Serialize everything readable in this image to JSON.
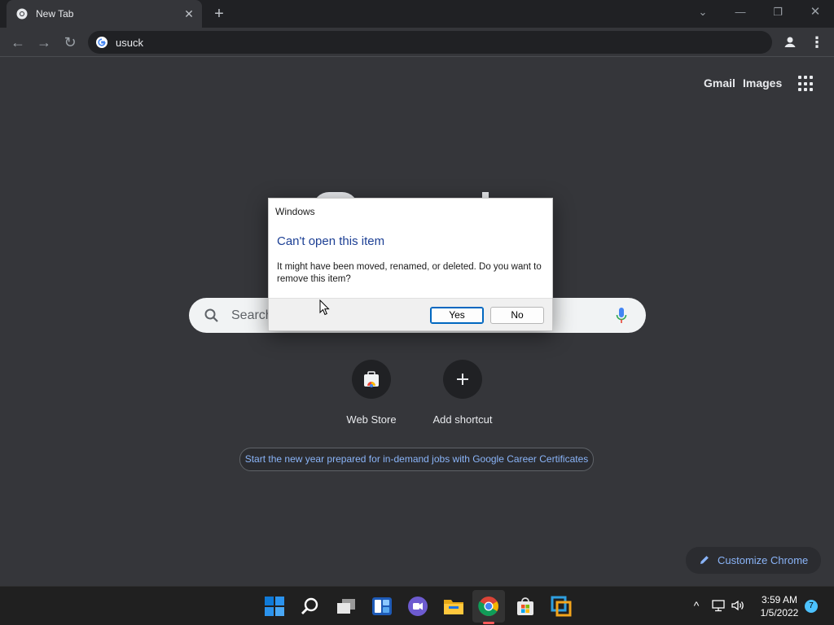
{
  "browser": {
    "tab": {
      "title": "New Tab"
    },
    "omnibox": {
      "value": "usuck"
    }
  },
  "ntp": {
    "top_links": {
      "gmail": "Gmail",
      "images": "Images"
    },
    "search_placeholder": "Search",
    "shortcuts": [
      {
        "label": "Web Store"
      },
      {
        "label": "Add shortcut"
      }
    ],
    "promo": "Start the new year prepared for in-demand jobs with Google Career Certificates",
    "customize_label": "Customize Chrome"
  },
  "dialog": {
    "caption": "Windows",
    "heading": "Can't open this item",
    "body": "It might have been moved, renamed, or deleted. Do you want to remove this item?",
    "yes_label": "Yes",
    "no_label": "No"
  },
  "taskbar": {
    "time": "3:59 AM",
    "date": "1/5/2022",
    "notification_count": "7"
  },
  "icons": {
    "taskbar": [
      "start-icon",
      "search-icon",
      "task-view-icon",
      "widgets-icon",
      "chat-icon",
      "file-explorer-icon",
      "chrome-icon",
      "store-icon",
      "app-icon"
    ]
  },
  "colors": {
    "chrome_dark_bg": "#35363a",
    "tab_strip_bg": "#202124",
    "link_blue": "#8ab4f8",
    "dialog_heading": "#1c3f94",
    "taskbar_bg": "#202020"
  }
}
